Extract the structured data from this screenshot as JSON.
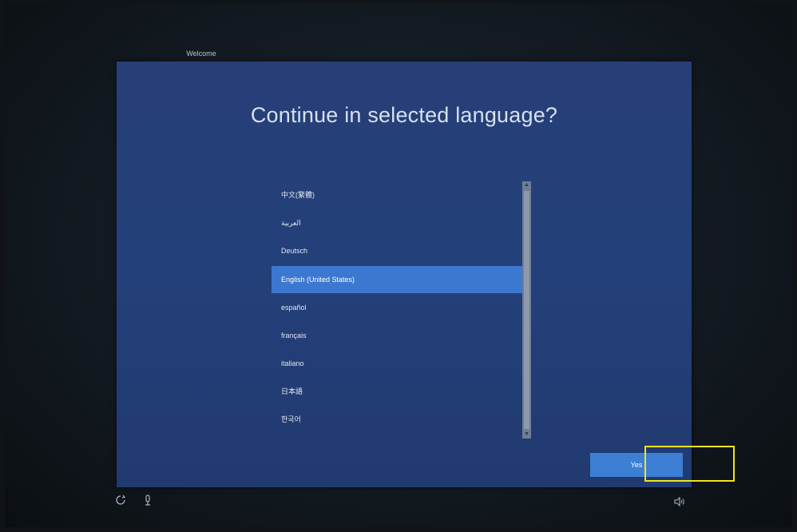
{
  "tab": {
    "label": "Welcome"
  },
  "title": "Continue in selected language?",
  "languages": [
    "中文(繁體)",
    "العربية",
    "Deutsch",
    "English (United States)",
    "español",
    "français",
    "italiano",
    "日本語",
    "한국어"
  ],
  "selected_language": "English (United States)",
  "yes_label": "Yes",
  "icons": {
    "ease_of_access": "ease-of-access-icon",
    "microphone": "microphone-icon",
    "volume": "volume-icon"
  },
  "colors": {
    "panel": "#24407a",
    "selection": "#3c78d0",
    "button": "#3c7fd4",
    "highlight": "#f2e51d"
  }
}
